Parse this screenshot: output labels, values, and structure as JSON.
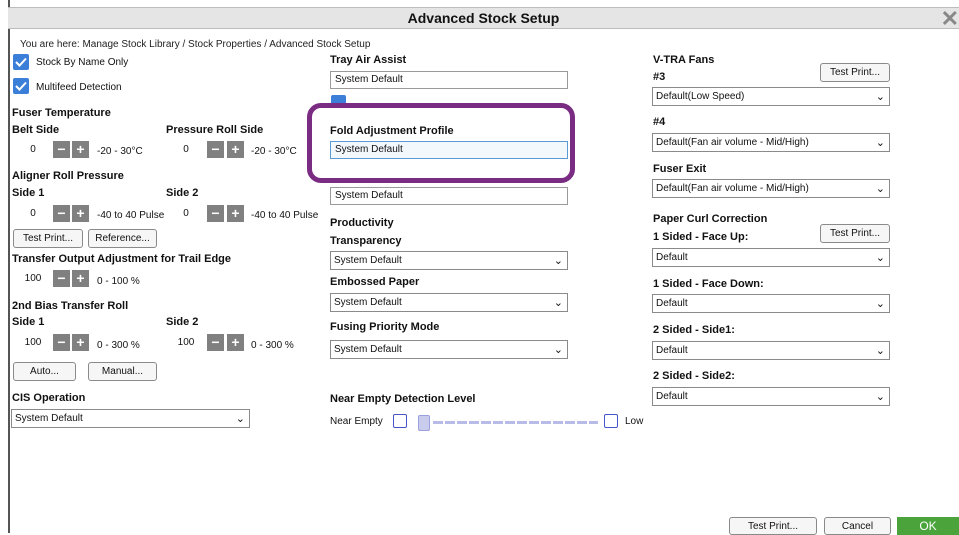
{
  "window": {
    "title": "Advanced Stock Setup"
  },
  "breadcrumb": "You are here: Manage Stock Library / Stock Properties / Advanced Stock Setup",
  "left": {
    "stock_by_name_only": "Stock By Name Only",
    "multifeed_detection": "Multifeed Detection",
    "fuser_temperature": "Fuser Temperature",
    "belt_side": "Belt Side",
    "belt_side_value": "0",
    "belt_range": "-20 - 30°C",
    "pressure_roll_side": "Pressure Roll Side",
    "pressure_value": "0",
    "pressure_range": "-20 - 30°C",
    "aligner_roll_pressure": "Aligner Roll Pressure",
    "aligner_side1": "Side 1",
    "aligner_side2": "Side 2",
    "aligner_side1_value": "0",
    "aligner_side1_range": "-40 to 40 Pulse",
    "aligner_side2_value": "0",
    "aligner_side2_range": "-40 to 40 Pulse",
    "test_print": "Test Print...",
    "reference": "Reference...",
    "transfer_output": "Transfer Output Adjustment for Trail Edge",
    "transfer_value": "100",
    "transfer_range": "0 - 100 %",
    "bias_transfer_roll": "2nd Bias Transfer Roll",
    "bias_side1": "Side 1",
    "bias_side2": "Side 2",
    "bias_side1_value": "100",
    "bias_side1_range": "0 - 300 %",
    "bias_side2_value": "100",
    "bias_side2_range": "0 - 300 %",
    "auto": "Auto...",
    "manual": "Manual...",
    "cis_operation": "CIS Operation",
    "cis_value": "System Default",
    "minus": "−",
    "plus": "+"
  },
  "middle": {
    "tray_air_assist": "Tray Air Assist",
    "tray_air_value": "System Default",
    "fold_adjustment_profile": "Fold Adjustment Profile",
    "fold_value": "System Default",
    "aligner_roll_value": "System Default",
    "productivity": "Productivity",
    "transparency": "Transparency",
    "transparency_value": "System Default",
    "embossed_paper": "Embossed Paper",
    "embossed_value": "System Default",
    "fusing_priority_mode": "Fusing Priority Mode",
    "fusing_value": "System Default",
    "near_empty_detection_level": "Near Empty Detection Level",
    "near_empty": "Near Empty",
    "low": "Low",
    "near_empty_level_fraction": 0.0
  },
  "right": {
    "vtra_fans": "V-TRA Fans",
    "fan3": "#3",
    "fan3_test_print": "Test Print...",
    "fan3_value": "Default(Low Speed)",
    "fan4": "#4",
    "fan4_value": "Default(Fan air volume - Mid/High)",
    "fuser_exit": "Fuser Exit",
    "fuser_exit_value": "Default(Fan air volume - Mid/High)",
    "paper_curl_correction": "Paper Curl Correction",
    "curl_test_print": "Test Print...",
    "one_sided_face_up": "1 Sided - Face Up:",
    "one_sided_face_up_value": "Default",
    "one_sided_face_down": "1 Sided - Face Down:",
    "one_sided_face_down_value": "Default",
    "two_sided_side1": "2 Sided - Side1:",
    "two_sided_side1_value": "Default",
    "two_sided_side2": "2 Sided - Side2:",
    "two_sided_side2_value": "Default"
  },
  "footer": {
    "test_print": "Test Print...",
    "cancel": "Cancel",
    "ok": "OK"
  },
  "colors": {
    "accent": "#3b7fd9",
    "highlight_box": "#7a2b82",
    "ok_green": "#4aa43b",
    "stepper": "#808080"
  }
}
